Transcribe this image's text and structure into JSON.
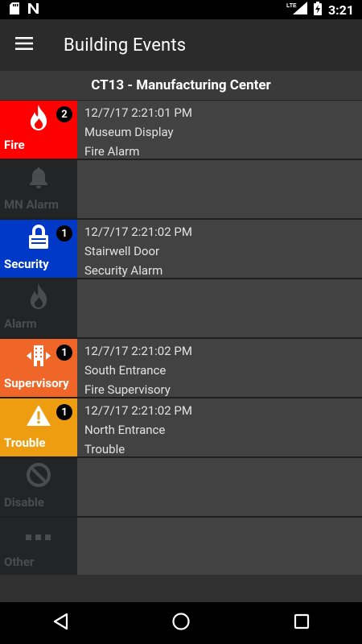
{
  "status_bar": {
    "time": "3:21",
    "icons": [
      "sd-card-icon",
      "n-notification-icon",
      "lte-signal-icon",
      "battery-charging-icon"
    ]
  },
  "app_bar": {
    "title": "Building Events",
    "menu_icon": "hamburger-menu-icon"
  },
  "location": {
    "title": "CT13 - Manufacturing Center"
  },
  "events": [
    {
      "type": "Fire",
      "color": "#ff0000",
      "icon": "flame-icon",
      "badge": "2",
      "active": true,
      "timestamp": "12/7/17 2:21:01 PM",
      "location": "Museum Display",
      "description": "Fire Alarm"
    },
    {
      "type": "MN Alarm",
      "color": "#222425",
      "icon": "bell-icon",
      "badge": "",
      "active": false,
      "timestamp": "",
      "location": "",
      "description": ""
    },
    {
      "type": "Security",
      "color": "#0038c8",
      "icon": "lock-icon",
      "badge": "1",
      "active": true,
      "timestamp": "12/7/17 2:21:02 PM",
      "location": "Stairwell Door",
      "description": "Security Alarm"
    },
    {
      "type": "Alarm",
      "color": "#222425",
      "icon": "flame-icon",
      "badge": "",
      "active": false,
      "timestamp": "",
      "location": "",
      "description": ""
    },
    {
      "type": "Supervisory",
      "color": "#f06628",
      "icon": "building-arrows-icon",
      "badge": "1",
      "active": true,
      "timestamp": "12/7/17 2:21:02 PM",
      "location": "South Entrance",
      "description": "Fire Supervisory"
    },
    {
      "type": "Trouble",
      "color": "#ee9d10",
      "icon": "warning-triangle-icon",
      "badge": "1",
      "active": true,
      "timestamp": "12/7/17 2:21:02 PM",
      "location": "North Entrance",
      "description": "Trouble"
    },
    {
      "type": "Disable",
      "color": "#222425",
      "icon": "disable-circle-icon",
      "badge": "",
      "active": false,
      "timestamp": "",
      "location": "",
      "description": ""
    },
    {
      "type": "Other",
      "color": "#222425",
      "icon": "dots-icon",
      "badge": "",
      "active": false,
      "timestamp": "",
      "location": "",
      "description": ""
    }
  ],
  "nav_bar": {
    "buttons": [
      "back-icon",
      "home-icon",
      "recents-icon"
    ]
  }
}
